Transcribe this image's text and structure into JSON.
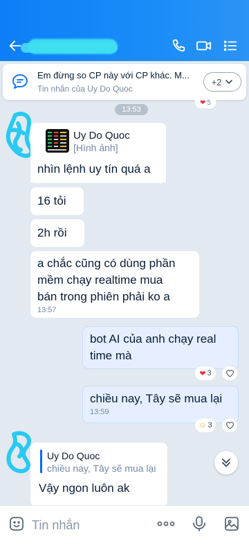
{
  "header": {
    "back_icon": "arrow-left-icon",
    "contact_name_redacted": true,
    "actions": [
      "phone-icon",
      "video-call-icon",
      "list-menu-icon"
    ]
  },
  "pinned": {
    "text": "Em đừng so CP này với CP khác. M...",
    "sub": "Tin nhắn của Uy Do Quoc",
    "more_count": "+2"
  },
  "above_reaction": "5",
  "time_divider": "13:53",
  "messages": [
    {
      "type": "share",
      "title": "Uy Do Quoc",
      "subtitle": "[Hình ảnh]"
    },
    {
      "type": "text",
      "text": "nhìn lệnh uy tín quá a"
    },
    {
      "type": "text",
      "text": "16 tỏi"
    },
    {
      "type": "text",
      "text": "2h rồi"
    },
    {
      "type": "text",
      "lines": [
        "a chắc cũng có dùng phần",
        "mềm chạy realtime mua",
        "bán trong phiên phải ko a"
      ],
      "time": "13:57"
    },
    {
      "type": "text_out",
      "lines": [
        "bot AI của anh chạy real",
        "time mà"
      ],
      "reaction_count": "3"
    },
    {
      "type": "text_out",
      "text": "chiều nay, Tây sẽ mua lại",
      "time": "13:59",
      "reaction_count": "3"
    },
    {
      "type": "reply",
      "quote_name": "Uy Do Quoc",
      "quote_text": "chiều nay, Tây sẽ mua lại",
      "text": "Vậy ngon luôn ak"
    }
  ],
  "input": {
    "placeholder": "Tin nhắn"
  },
  "colors": {
    "header": "#0d7ef7",
    "background": "#e2e9f1",
    "outgoing_bubble": "#e5efff",
    "accent": "#0068ff"
  }
}
